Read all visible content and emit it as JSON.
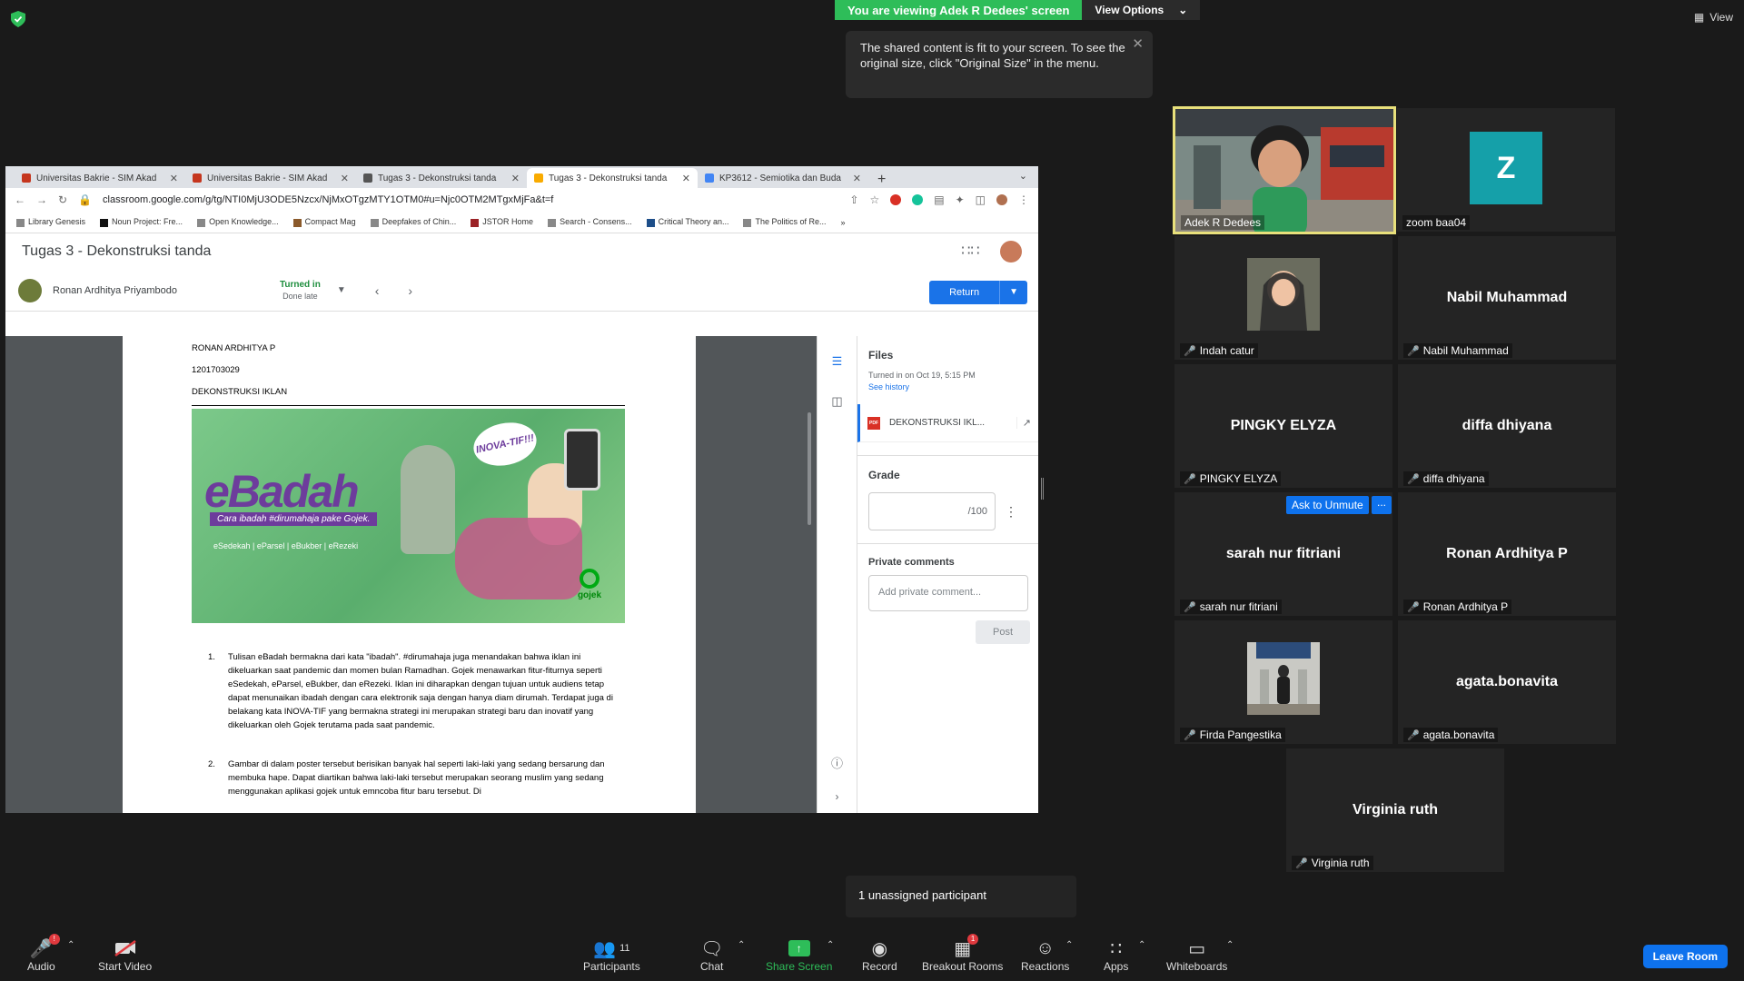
{
  "banner": {
    "viewing": "You are viewing Adek R Dedees' screen",
    "view_options": "View Options",
    "top_view": "View"
  },
  "tooltip": {
    "text": "The shared content is fit to your screen. To see the original size, click \"Original Size\" in the menu."
  },
  "browser": {
    "tabs": [
      {
        "label": "Universitas Bakrie - SIM Akad",
        "color": "#c5361e"
      },
      {
        "label": "Universitas Bakrie - SIM Akad",
        "color": "#c5361e"
      },
      {
        "label": "Tugas 3 - Dekonstruksi tanda",
        "color": "#555555"
      },
      {
        "label": "Tugas 3 - Dekonstruksi tanda",
        "color": "#f9ab00"
      },
      {
        "label": "KP3612 - Semiotika dan Buda",
        "color": "#4285f4"
      }
    ],
    "url": "classroom.google.com/g/tg/NTI0MjU3ODE5Nzcx/NjMxOTgzMTY1OTM0#u=Njc0OTM2MTgxMjFa&t=f",
    "bookmarks": [
      "Library Genesis",
      "Noun Project: Fre...",
      "Open Knowledge...",
      "Compact Mag",
      "Deepfakes of Chin...",
      "JSTOR Home",
      "Search - Consens...",
      "Critical Theory an...",
      "The Politics of Re..."
    ]
  },
  "classroom": {
    "title": "Tugas 3 - Dekonstruksi tanda",
    "student_name": "Ronan Ardhitya Priyambodo",
    "status": "Turned in",
    "status_sub": "Done late",
    "return_label": "Return"
  },
  "doc": {
    "name": "RONAN ARDHITYA P",
    "id": "1201703029",
    "heading": "DEKONSTRUKSI IKLAN",
    "ad": {
      "title": "eBadah",
      "subtitle": "Cara ibadah #dirumahaja pake Gojek.",
      "links": "eSedekah  |  eParsel  |  eBukber  |  eRezeki",
      "bubble": "INOVA-TIF!!!",
      "logo": "gojek"
    },
    "items": [
      {
        "num": "1.",
        "text": "Tulisan eBadah bermakna dari kata \"ibadah\". #dirumahaja juga menandakan bahwa iklan ini dikeluarkan saat pandemic dan momen bulan Ramadhan. Gojek menawarkan fitur-fiturnya seperti eSedekah, eParsel, eBukber, dan eRezeki. Iklan ini diharapkan dengan tujuan untuk audiens tetap dapat menunaikan ibadah dengan cara elektronik saja dengan hanya diam dirumah.  Terdapat juga di belakang kata INOVA-TIF yang bermakna strategi ini merupakan strategi baru dan inovatif yang dikeluarkan oleh Gojek terutama pada saat pandemic."
      },
      {
        "num": "2.",
        "text": "Gambar di dalam poster tersebut berisikan banyak hal seperti laki-laki yang sedang bersarung dan membuka hape. Dapat diartikan bahwa laki-laki tersebut merupakan seorang muslim yang sedang menggunakan aplikasi gojek untuk emncoba fitur baru tersebut. Di"
      }
    ]
  },
  "panel": {
    "files_title": "Files",
    "turned_in_time": "Turned in on Oct 19, 5:15 PM",
    "see_history": "See history",
    "file_name": "DEKONSTRUKSI IKL...",
    "pdf": "PDF",
    "grade_title": "Grade",
    "grade_suffix": "/100",
    "private_title": "Private comments",
    "private_placeholder": "Add private comment...",
    "post_label": "Post"
  },
  "participants": [
    {
      "name": "Adek R Dedees",
      "type": "video",
      "muted": false,
      "speaking": true
    },
    {
      "name": "zoom baa04",
      "type": "avatar",
      "initial": "Z",
      "muted": false
    },
    {
      "name": "Indah catur",
      "type": "photo",
      "muted": true
    },
    {
      "name": "Nabil Muhammad",
      "type": "name",
      "muted": true
    },
    {
      "name": "PINGKY ELYZA",
      "type": "name",
      "muted": true
    },
    {
      "name": "diffa dhiyana",
      "type": "name",
      "muted": true
    },
    {
      "name": "sarah nur fitriani",
      "type": "name",
      "muted": true
    },
    {
      "name": "Ronan Ardhitya P",
      "type": "name",
      "muted": true
    },
    {
      "name": "Firda Pangestika",
      "type": "photo",
      "muted": true
    },
    {
      "name": "agata.bonavita",
      "type": "name",
      "muted": true
    },
    {
      "name": "Virginia ruth",
      "type": "name",
      "muted": true
    }
  ],
  "ask_unmute": "Ask to Unmute",
  "tile_more": "...",
  "unassigned": "1 unassigned participant",
  "toolbar": {
    "audio": "Audio",
    "audio_badge": "!",
    "start_video": "Start Video",
    "participants": "Participants",
    "participants_count": "11",
    "chat": "Chat",
    "share_screen": "Share Screen",
    "record": "Record",
    "breakout_rooms": "Breakout Rooms",
    "breakout_badge": "1",
    "reactions": "Reactions",
    "apps": "Apps",
    "whiteboards": "Whiteboards",
    "leave": "Leave Room"
  },
  "colors": {
    "accent": "#0e72ed",
    "share_green": "#2ebd59",
    "mute_red": "#e0393e",
    "speaking_border": "#e8e07b"
  }
}
